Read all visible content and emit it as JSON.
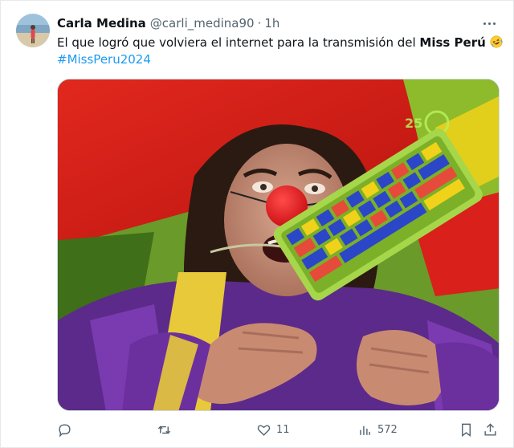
{
  "author": {
    "name": "Carla Medina",
    "handle": "@carli_medina90",
    "separator": "·",
    "time": "1h"
  },
  "tweet": {
    "text_before": "El que logró que volviera el internet para la transmisión del ",
    "text_bold": "Miss Perú",
    "emoji": "rolling-on-the-floor-laughing-emoji",
    "hashtag": "#MissPeru2024"
  },
  "media": {
    "description_icon": "clown-with-keyboard-image",
    "watermark": "25"
  },
  "actions": {
    "replies": "",
    "retweets": "",
    "likes": "11",
    "views": "572"
  },
  "icons": {
    "reply": "reply-icon",
    "retweet": "retweet-icon",
    "like": "heart-icon",
    "views": "views-icon",
    "bookmark": "bookmark-icon",
    "share": "share-icon",
    "more": "more-icon"
  },
  "colors": {
    "accent": "#1d9bf0",
    "secondary_text": "#536471",
    "primary_text": "#0f1419"
  }
}
